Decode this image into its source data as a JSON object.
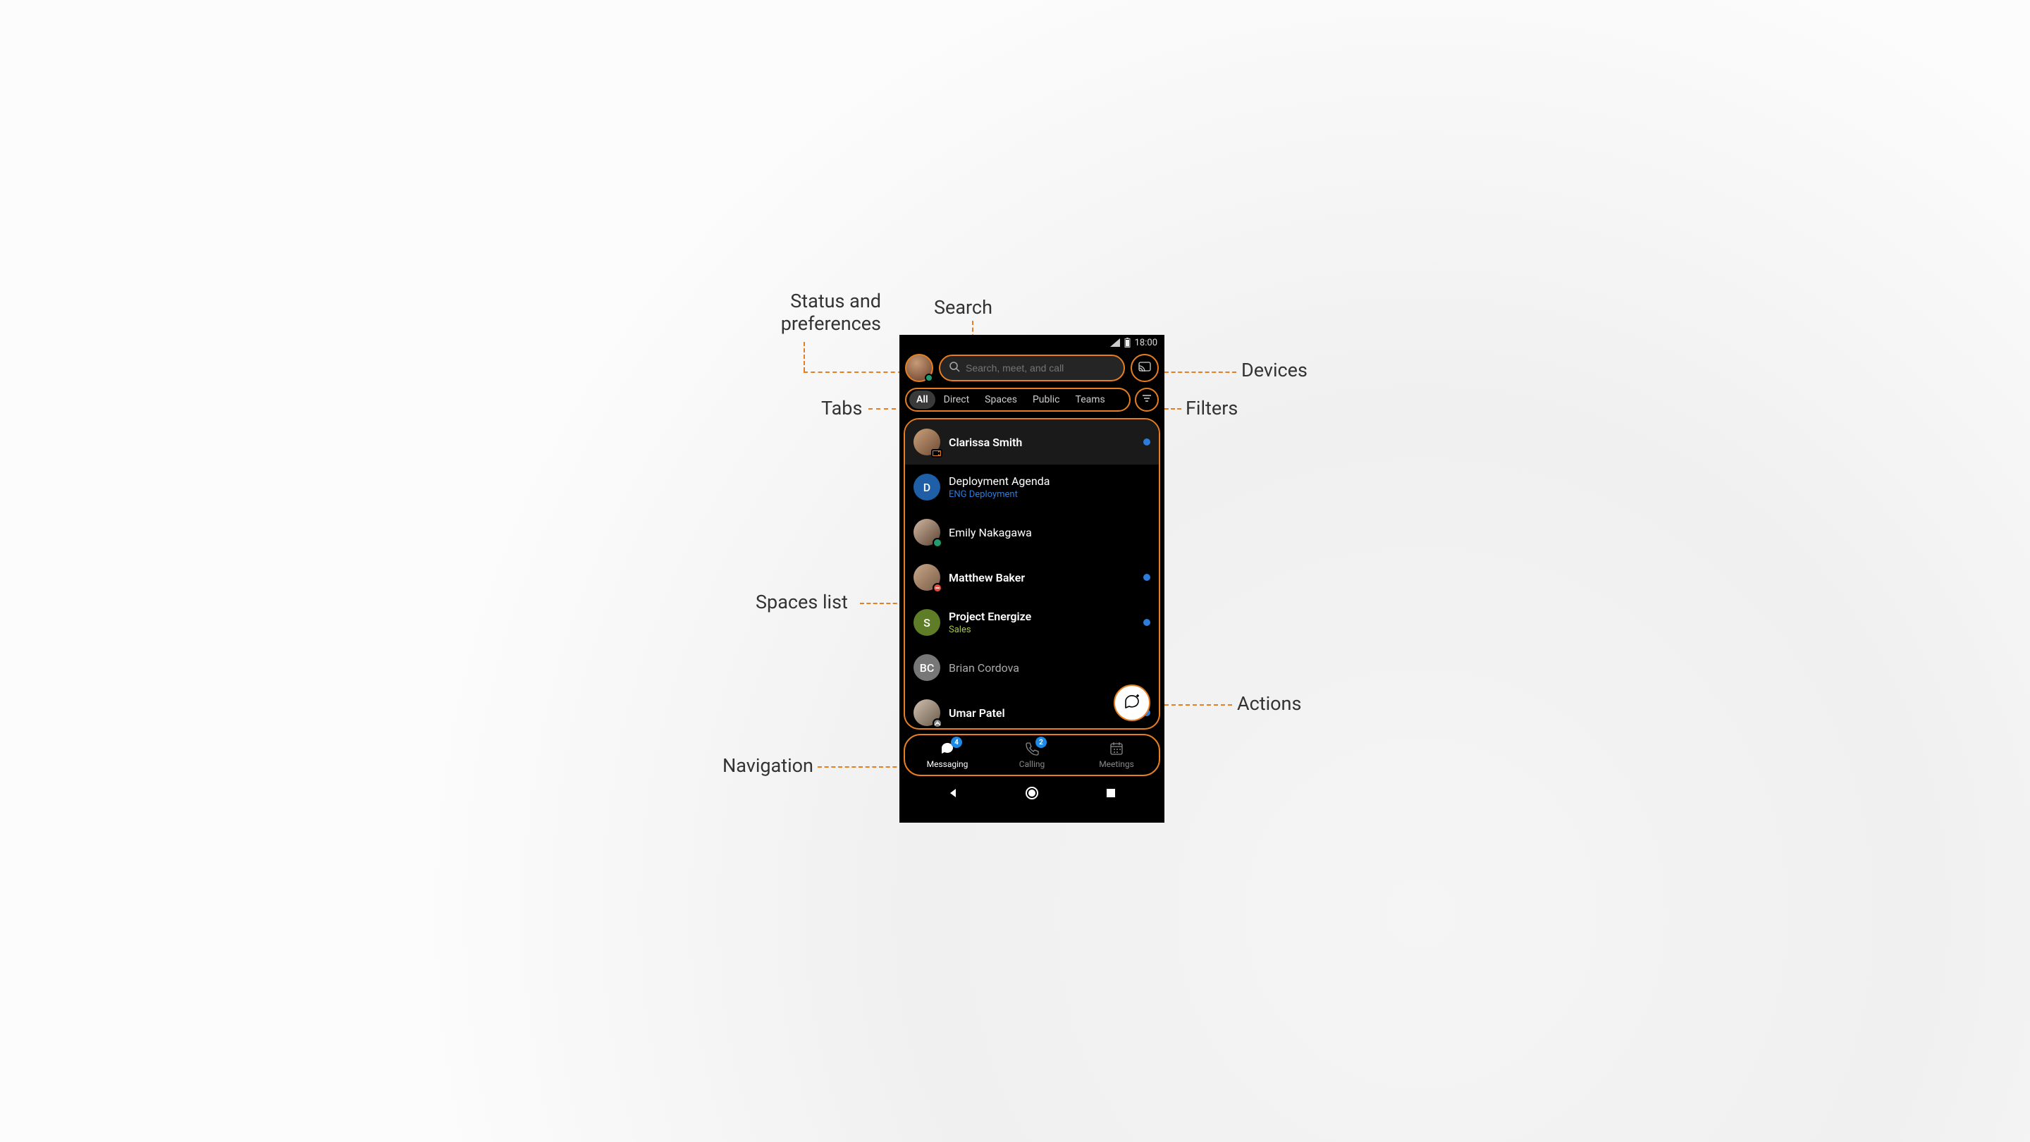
{
  "callouts": {
    "status_prefs": "Status and\npreferences",
    "search": "Search",
    "devices": "Devices",
    "tabs": "Tabs",
    "filters": "Filters",
    "spaces_list": "Spaces list",
    "actions": "Actions",
    "navigation": "Navigation"
  },
  "status_bar": {
    "time": "18:00"
  },
  "top": {
    "presence_color": "#1f9d6e",
    "search_placeholder": "Search, meet, and call"
  },
  "tabs": [
    {
      "label": "All",
      "active": true
    },
    {
      "label": "Direct",
      "active": false
    },
    {
      "label": "Spaces",
      "active": false
    },
    {
      "label": "Public",
      "active": false
    },
    {
      "label": "Teams",
      "active": false
    }
  ],
  "spaces": [
    {
      "title": "Clarissa Smith",
      "subtitle": "",
      "subtitle_color": "",
      "unread": true,
      "selected": true,
      "bold": true,
      "avatar": {
        "type": "photo",
        "bg": "linear-gradient(135deg,#caa27a,#6e4a34)",
        "badge": "camera",
        "badge_color": "#e67e22"
      }
    },
    {
      "title": "Deployment Agenda",
      "subtitle": "ENG Deployment",
      "subtitle_color": "#2d7bdb",
      "unread": false,
      "selected": false,
      "bold": false,
      "avatar": {
        "type": "initial",
        "text": "D",
        "bg": "#1e5fa8"
      }
    },
    {
      "title": "Emily Nakagawa",
      "subtitle": "",
      "subtitle_color": "",
      "unread": false,
      "selected": false,
      "bold": false,
      "avatar": {
        "type": "photo",
        "bg": "linear-gradient(135deg,#d1b8a1,#5c4234)",
        "badge": "dot",
        "badge_color": "#1f9d6e"
      }
    },
    {
      "title": "Matthew Baker",
      "subtitle": "",
      "subtitle_color": "",
      "unread": true,
      "selected": false,
      "bold": true,
      "avatar": {
        "type": "photo",
        "bg": "linear-gradient(135deg,#c7a98a,#7a5a45)",
        "badge": "dnd",
        "badge_color": "#e74c3c"
      }
    },
    {
      "title": "Project Energize",
      "subtitle": "Sales",
      "subtitle_color": "#a6c34c",
      "unread": true,
      "selected": false,
      "bold": true,
      "avatar": {
        "type": "initial",
        "text": "S",
        "bg": "#5f7c27"
      }
    },
    {
      "title": "Brian Cordova",
      "subtitle": "",
      "subtitle_color": "",
      "unread": false,
      "selected": false,
      "bold": false,
      "title_muted": true,
      "avatar": {
        "type": "initial",
        "text": "BC",
        "bg": "#777"
      }
    },
    {
      "title": "Umar Patel",
      "subtitle": "",
      "subtitle_color": "",
      "unread": true,
      "selected": false,
      "bold": true,
      "avatar": {
        "type": "photo",
        "bg": "linear-gradient(135deg,#d0c0b0,#6a5a4a)",
        "badge": "ooo",
        "badge_color": "#888"
      }
    }
  ],
  "nav": [
    {
      "label": "Messaging",
      "icon": "chat",
      "badge": "4",
      "active": true
    },
    {
      "label": "Calling",
      "icon": "phone",
      "badge": "2",
      "active": false
    },
    {
      "label": "Meetings",
      "icon": "calendar",
      "badge": "",
      "active": false
    }
  ],
  "colors": {
    "highlight": "#e67e22",
    "unread": "#2d7bdb",
    "active_green": "#1f9d6e",
    "dnd_red": "#e74c3c"
  }
}
